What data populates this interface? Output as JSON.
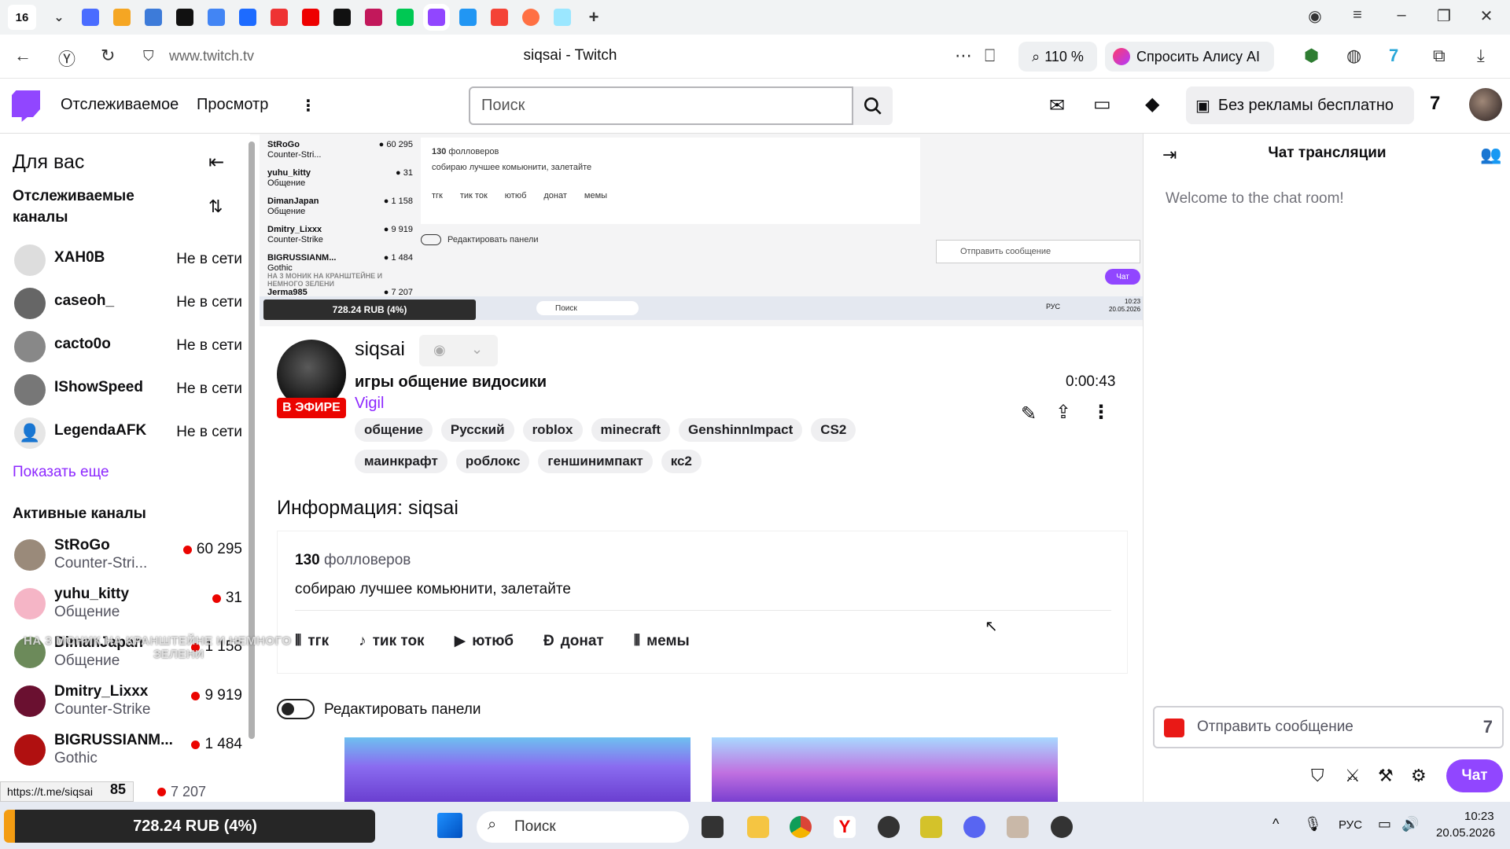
{
  "browser": {
    "tab_count": "16",
    "url": "www.twitch.tv",
    "page_title": "siqsai - Twitch",
    "zoom": "110 %",
    "alice_label": "Спросить Алису AI"
  },
  "topnav": {
    "following": "Отслеживаемое",
    "browse": "Просмотр",
    "search_placeholder": "Поиск",
    "no_ads": "Без рекламы бесплатно"
  },
  "sidebar": {
    "title": "Для вас",
    "followed_title": "Отслеживаемые каналы",
    "followed": [
      {
        "name": "XAH0B",
        "status": "Не в сети"
      },
      {
        "name": "caseoh_",
        "status": "Не в сети"
      },
      {
        "name": "cacto0o",
        "status": "Не в сети"
      },
      {
        "name": "IShowSpeed",
        "status": "Не в сети"
      },
      {
        "name": "LegendaAFK",
        "status": "Не в сети"
      }
    ],
    "show_more": "Показать еще",
    "active_title": "Активные каналы",
    "active": [
      {
        "name": "StRoGo",
        "game": "Counter-Stri...",
        "viewers": "60 295"
      },
      {
        "name": "yuhu_kitty",
        "game": "Общение",
        "viewers": "31"
      },
      {
        "name": "DimanJapan",
        "game": "Общение",
        "viewers": "1 158"
      },
      {
        "name": "Dmitry_Lixxx",
        "game": "Counter-Strike",
        "viewers": "9 919"
      },
      {
        "name": "BIGRUSSIANM...",
        "game": "Gothic",
        "viewers": "1 484"
      }
    ]
  },
  "preview": {
    "followers": "130",
    "followers_label": "фолловеров",
    "desc": "собираю лучшее комьюнити, залетайте",
    "links": [
      "тгк",
      "тик ток",
      "ютюб",
      "донат",
      "мемы"
    ],
    "edit_panels": "Редактировать панели",
    "chat_placeholder": "Отправить сообщение",
    "chat_btn": "Чат",
    "earn": "728.24 RUB (4%)",
    "search": "Поиск",
    "time": "10:23",
    "date": "20.05.2026",
    "lang": "РУС",
    "sidebar": [
      {
        "name": "StRoGo",
        "game": "Counter-Stri...",
        "viewers": "60 295"
      },
      {
        "name": "yuhu_kitty",
        "game": "Общение",
        "viewers": "31"
      },
      {
        "name": "DimanJapan",
        "game": "Общение",
        "viewers": "1 158"
      },
      {
        "name": "Dmitry_Lixxx",
        "game": "Counter-Strike",
        "viewers": "9 919"
      },
      {
        "name": "BIGRUSSIANM...",
        "game": "Gothic",
        "viewers": "1 484"
      },
      {
        "name": "Jerma985",
        "game": "",
        "viewers": "7 207"
      }
    ]
  },
  "stream": {
    "name": "siqsai",
    "live": "В ЭФИРЕ",
    "title": "игры общение видосики",
    "game": "Vigil",
    "uptime": "0:00:43",
    "tags": [
      "общение",
      "Русский",
      "roblox",
      "minecraft",
      "GenshinnImpact",
      "CS2",
      "маинкрафт",
      "роблокс",
      "геншинимпакт",
      "кс2"
    ]
  },
  "info": {
    "title": "Информация: siqsai",
    "followers": "130",
    "followers_label": "фолловеров",
    "desc": "собираю лучшее комьюнити, залетайте",
    "links": [
      "тгк",
      "тик ток",
      "ютюб",
      "донат",
      "мемы"
    ],
    "edit_panels": "Редактировать панели"
  },
  "overlay": {
    "line1": "НА 3 МОНИК НА КРАНШТЕЙНЕ И НЕМНОГО",
    "line2": "ЗЕЛЕНИ",
    "status_url": "https://t.me/siqsai",
    "cutoff_number": "85",
    "cutoff_viewers": "7 207",
    "mini_line1": "НА 3 МОНИК НА КРАНШТЕЙНЕ И НЕМНОГО",
    "mini_line2": "ЗЕЛЕНИ"
  },
  "chat": {
    "title": "Чат трансляции",
    "welcome": "Welcome to the chat room!",
    "placeholder": "Отправить сообщение",
    "chat_button": "Чат"
  },
  "taskbar": {
    "earn": "728.24 RUB (4%)",
    "search": "Поиск",
    "lang": "РУС",
    "time": "10:23",
    "date": "20.05.2026"
  },
  "colors": {
    "twitch_purple": "#9146ff",
    "live_red": "#eb0400",
    "link_purple": "#8d28ff"
  }
}
